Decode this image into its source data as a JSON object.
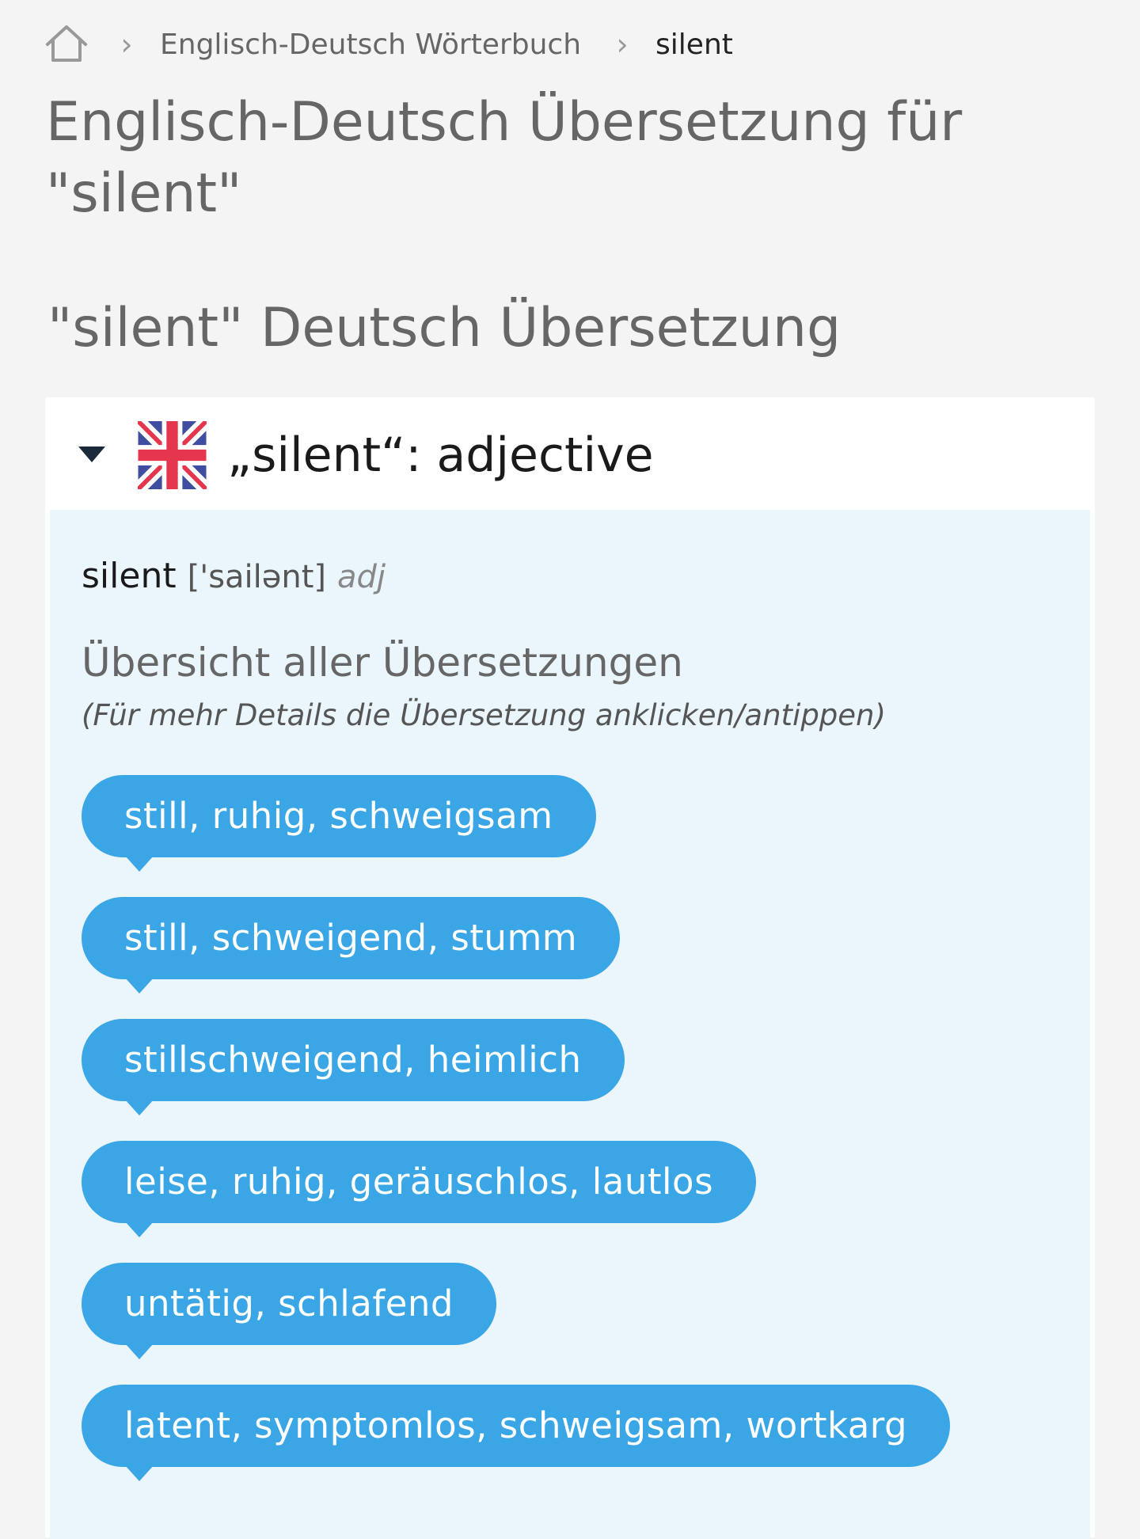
{
  "breadcrumb": {
    "home_icon": "home-icon",
    "separator": "›",
    "dictionary_link": "Englisch-Deutsch Wörterbuch",
    "current": "silent"
  },
  "page_title": "Englisch-Deutsch Übersetzung für \"silent\"",
  "section_title": "\"silent\" Deutsch Übersetzung",
  "entry": {
    "collapse_icon": "caret-down-icon",
    "flag_icon": "uk-flag-icon",
    "heading": "„silent“: adjective",
    "headword": "silent",
    "pronunciation": "['sailənt]",
    "part_of_speech": "adj",
    "overview_title": "Übersicht aller Übersetzungen",
    "overview_hint": "(Für mehr Details die Übersetzung anklicken/antippen)",
    "translations": [
      "still, ruhig, schweigsam",
      "still, schweigend, stumm",
      "stillschweigend, heimlich",
      "leise, ruhig, geräuschlos, lautlos",
      "untätig, schlafend",
      "latent, symptomlos, schweigsam, wortkarg"
    ]
  },
  "colors": {
    "background": "#f4f4f4",
    "card": "#ffffff",
    "card_body": "#eaf5fc",
    "chip": "#3aa6e6",
    "chip_text": "#ffffff"
  }
}
